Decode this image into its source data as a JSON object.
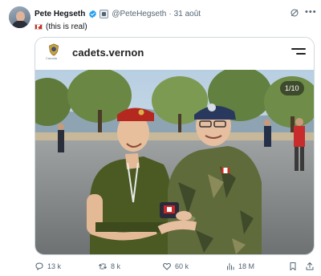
{
  "author": {
    "name": "Pete Hegseth",
    "handle": "@PeteHegseth",
    "separator": "·",
    "date": "31 août"
  },
  "tweet": {
    "text": "(this is real)",
    "flag_icon": "canada-flag-icon"
  },
  "card": {
    "site": "cadets.vernon",
    "crest_label": "Canada",
    "image_counter": "1/10"
  },
  "actions": {
    "replies": "13 k",
    "retweets": "8 k",
    "likes": "60 k",
    "views": "18 M"
  },
  "icons": {
    "verified": "verified-badge-icon",
    "grok": "grok-icon",
    "more": "more-icon",
    "reply": "reply-icon",
    "retweet": "retweet-icon",
    "like": "heart-icon",
    "views": "views-icon",
    "bookmark": "bookmark-icon",
    "share": "share-icon"
  },
  "colors": {
    "verified": "#1d9bf0",
    "text_secondary": "#536471",
    "border": "#cfd9de"
  }
}
